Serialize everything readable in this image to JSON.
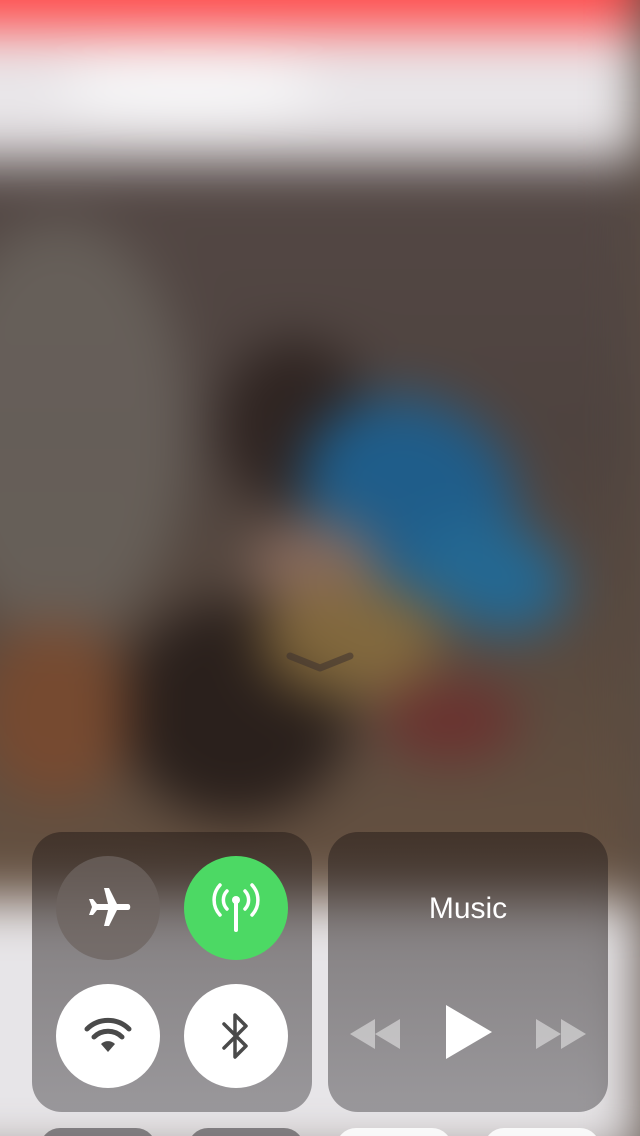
{
  "control_center": {
    "connectivity": {
      "airplane_mode": {
        "icon": "airplane-icon",
        "state": "off"
      },
      "cellular_data": {
        "icon": "cellular-antenna-icon",
        "state": "on",
        "color": "#4cd964"
      },
      "wifi": {
        "icon": "wifi-icon",
        "state": "on"
      },
      "bluetooth": {
        "icon": "bluetooth-icon",
        "state": "on"
      }
    },
    "music": {
      "title": "Music",
      "controls": {
        "rewind": {
          "icon": "rewind-icon"
        },
        "play": {
          "icon": "play-icon"
        },
        "fast_forward": {
          "icon": "fast-forward-icon"
        }
      }
    },
    "dismiss_handle": {
      "icon": "chevron-down-icon"
    }
  }
}
